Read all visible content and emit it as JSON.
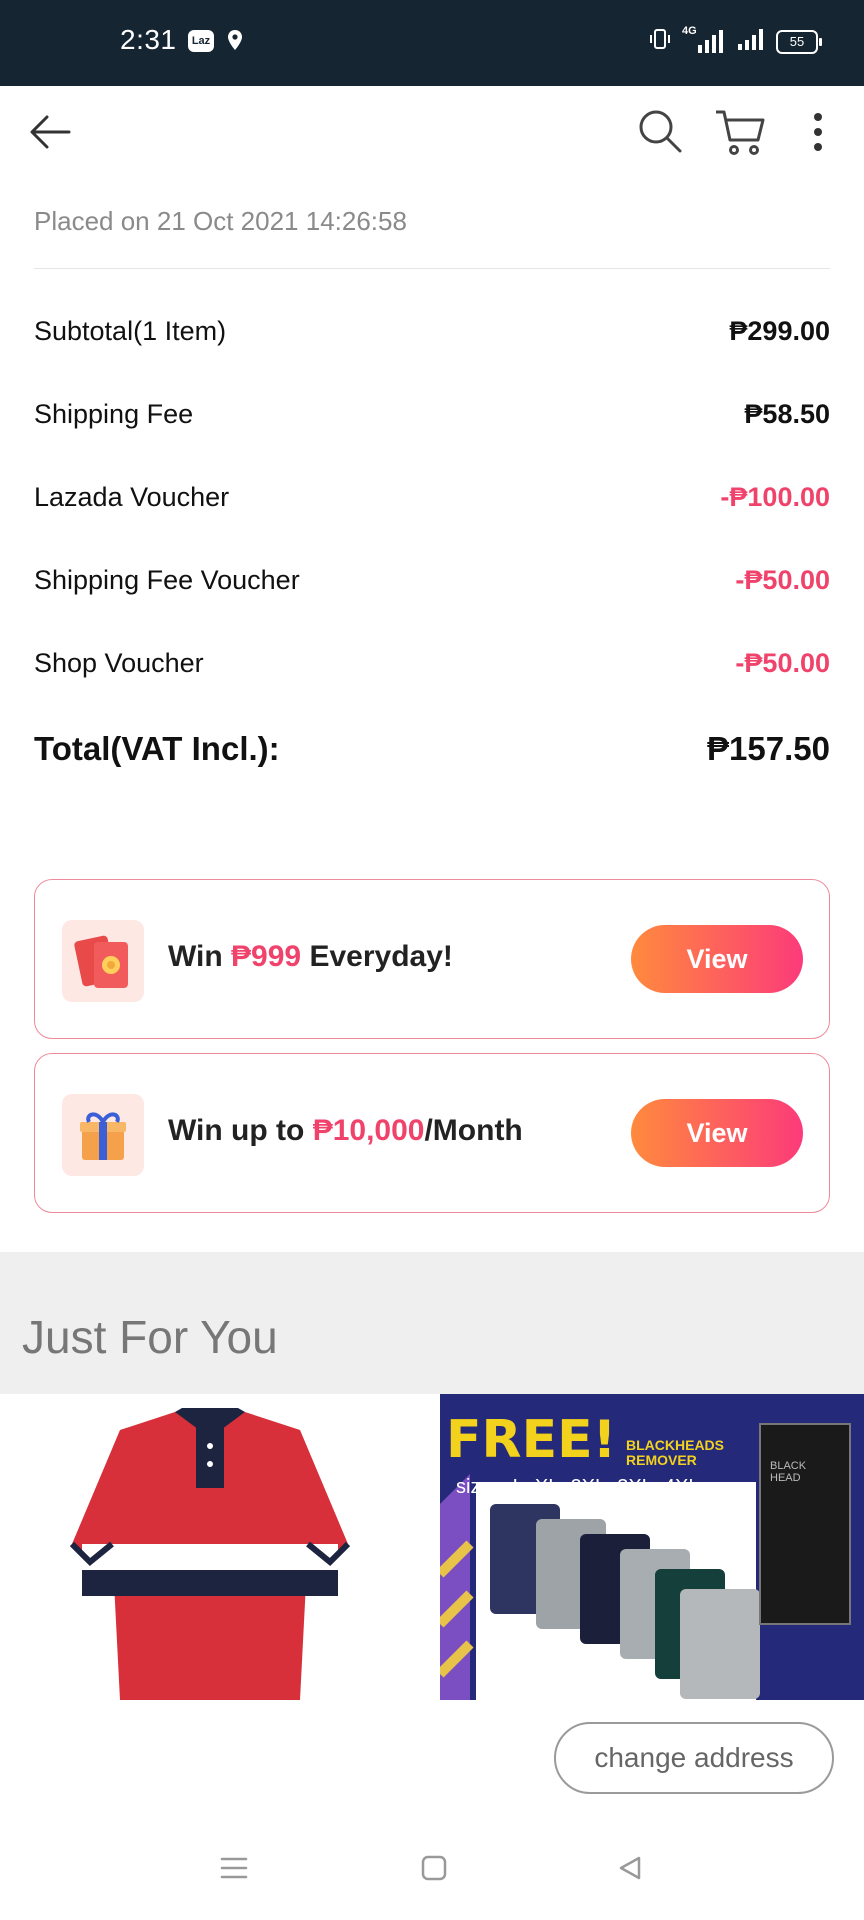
{
  "status_bar": {
    "time": "2:31",
    "app_badge": "Laz",
    "network": "4G",
    "battery": "55"
  },
  "order": {
    "placed_on": "Placed on 21 Oct 2021  14:26:58",
    "rows": [
      {
        "label": "Subtotal(1 Item)",
        "value": "₱299.00"
      },
      {
        "label": "Shipping Fee",
        "value": "₱58.50"
      },
      {
        "label": "Lazada Voucher",
        "value": "-₱100.00"
      },
      {
        "label": "Shipping Fee Voucher",
        "value": "-₱50.00"
      },
      {
        "label": "Shop Voucher",
        "value": "-₱50.00"
      }
    ],
    "total_label": "Total(VAT Incl.):",
    "total_value": "₱157.50"
  },
  "promos": [
    {
      "pre": "Win ",
      "highlight": "₱999",
      "post": " Everyday!",
      "button": "View",
      "icon": "red-envelope-icon"
    },
    {
      "pre": "Win up to ",
      "highlight": "₱10,000",
      "post": "/Month",
      "button": "View",
      "icon": "gift-box-icon"
    }
  ],
  "just_for_you": {
    "title": "Just For You",
    "products": [
      {
        "name": "red polo shirt with navy and white stripe"
      },
      {
        "banner_free": "FREE!",
        "banner_item": "BLACKHEADS REMOVER",
        "banner_sizes": "sizes: L, XL, 2XL, 3XL, 4XL",
        "pack_text": "BLACK HEAD"
      }
    ]
  },
  "change_address_label": "change address",
  "colors": {
    "status_bar": "#152532",
    "negative": "#f0436b",
    "button_gradient_start": "#ff8a3d",
    "button_gradient_end": "#fc3b7a"
  }
}
